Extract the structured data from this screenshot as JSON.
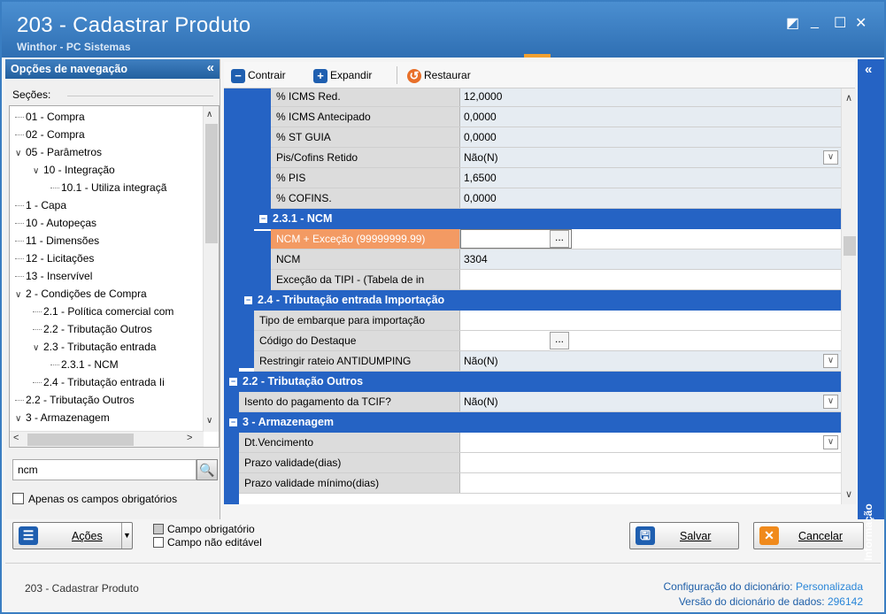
{
  "window": {
    "title": "203 - Cadastrar  Produto",
    "subtitle": "Winthor - PC Sistemas"
  },
  "nav": {
    "header": "Opções de navegação",
    "sections_label": "Seções:",
    "tree": [
      {
        "label": "01 - Compra",
        "level": 0
      },
      {
        "label": "02 - Compra",
        "level": 0
      },
      {
        "label": "05 - Parâmetros",
        "level": 0,
        "expanded": true
      },
      {
        "label": "10 - Integração",
        "level": 1,
        "expanded": true
      },
      {
        "label": "10.1 - Utiliza integraçã",
        "level": 2
      },
      {
        "label": "1 - Capa",
        "level": 0
      },
      {
        "label": "10 - Autopeças",
        "level": 0
      },
      {
        "label": "11 - Dimensões",
        "level": 0
      },
      {
        "label": "12 - Licitações",
        "level": 0
      },
      {
        "label": "13 - Inservível",
        "level": 0
      },
      {
        "label": "2 - Condições de Compra",
        "level": 0,
        "expanded": true
      },
      {
        "label": "2.1 - Política comercial com",
        "level": 1
      },
      {
        "label": "2.2 - Tributação Outros",
        "level": 1
      },
      {
        "label": "2.3 - Tributação entrada",
        "level": 1,
        "expanded": true
      },
      {
        "label": "2.3.1 - NCM",
        "level": 2
      },
      {
        "label": "2.4 - Tributação entrada Ii",
        "level": 1
      },
      {
        "label": "2.2 - Tributação Outros",
        "level": 0
      },
      {
        "label": "3 - Armazenagem",
        "level": 0,
        "expanded": true
      }
    ],
    "search_value": "ncm",
    "only_required_label": "Apenas os campos obrigatórios"
  },
  "toolbar": {
    "collapse_label": "Contrair",
    "expand_label": "Expandir",
    "restore_label": "Restaurar"
  },
  "grid": {
    "rows": [
      {
        "label": "% ICMS Red.",
        "value": "12,0000"
      },
      {
        "label": "% ICMS Antecipado",
        "value": "0,0000"
      },
      {
        "label": "% ST GUIA",
        "value": "0,0000"
      },
      {
        "label": "Pis/Cofins Retido",
        "value": "Não(N)"
      },
      {
        "label": "% PIS",
        "value": "1,6500"
      },
      {
        "label": "% COFINS.",
        "value": "0,0000"
      }
    ],
    "section_ncm": "2.3.1 - NCM",
    "ncm_rows": [
      {
        "label": "NCM + Exceção (99999999.99)",
        "value": ""
      },
      {
        "label": "NCM",
        "value": "3304"
      },
      {
        "label": "Exceção da TIPI - (Tabela de in",
        "value": ""
      }
    ],
    "section_import": "2.4 - Tributação entrada Importação",
    "import_rows": [
      {
        "label": "Tipo de embarque para importação",
        "value": ""
      },
      {
        "label": "Código do Destaque",
        "value": ""
      },
      {
        "label": "Restringir rateio ANTIDUMPING",
        "value": "Não(N)"
      }
    ],
    "section_outros": "2.2 - Tributação Outros",
    "outros_rows": [
      {
        "label": "Isento do pagamento da TCIF?",
        "value": "Não(N)"
      }
    ],
    "section_armazenagem": "3 - Armazenagem",
    "armazenagem_rows": [
      {
        "label": "Dt.Vencimento",
        "value": ""
      },
      {
        "label": "Prazo validade(dias)",
        "value": ""
      },
      {
        "label": "Prazo validade mínimo(dias)",
        "value": ""
      }
    ],
    "ellipsis": "..."
  },
  "info_panel": {
    "label": "Informação"
  },
  "bottom": {
    "actions_label": "Ações",
    "legend_required": "Campo obrigatório",
    "legend_noneditable": "Campo não editável",
    "save_label": "Salvar",
    "cancel_label": "Cancelar"
  },
  "footer": {
    "left": "203 - Cadastrar  Produto",
    "dict_config_key": "Configuração do dicionário:",
    "dict_config_value": "Personalizada",
    "dict_version_key": "Versão do dicionário de dados:",
    "dict_version_value": "296142"
  },
  "colors": {
    "title_bar": "#2f6fb3",
    "section_blue": "#2563c4",
    "selected_field": "#f39a63",
    "cancel_orange": "#f08a1c"
  }
}
